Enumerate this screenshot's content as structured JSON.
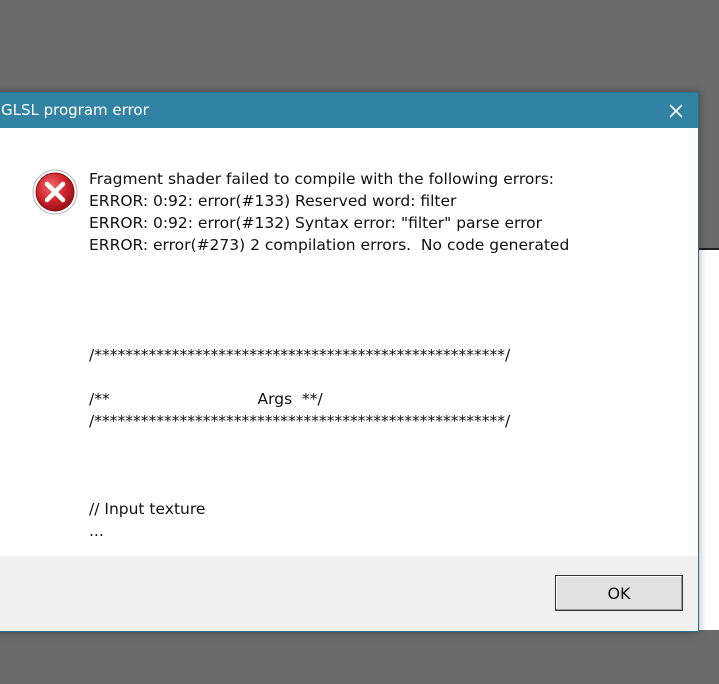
{
  "dialog": {
    "title": "GLSL program error",
    "close_icon": "close-icon",
    "error_icon": "error-icon",
    "message_lines": [
      "Fragment shader failed to compile with the following errors:",
      "ERROR: 0:92: error(#133) Reserved word: filter",
      "ERROR: 0:92: error(#132) Syntax error: \"filter\" parse error",
      "ERROR: error(#273) 2 compilation errors.  No code generated",
      "",
      "",
      "",
      "",
      "/*****************************************************/",
      "",
      "/**                              Args  **/",
      "/*****************************************************/",
      "",
      "",
      "",
      "// Input texture",
      "..."
    ],
    "ok_label": "OK"
  },
  "colors": {
    "titlebar": "#3282a3",
    "background": "#6b6b6b",
    "error_red": "#d0232b"
  }
}
